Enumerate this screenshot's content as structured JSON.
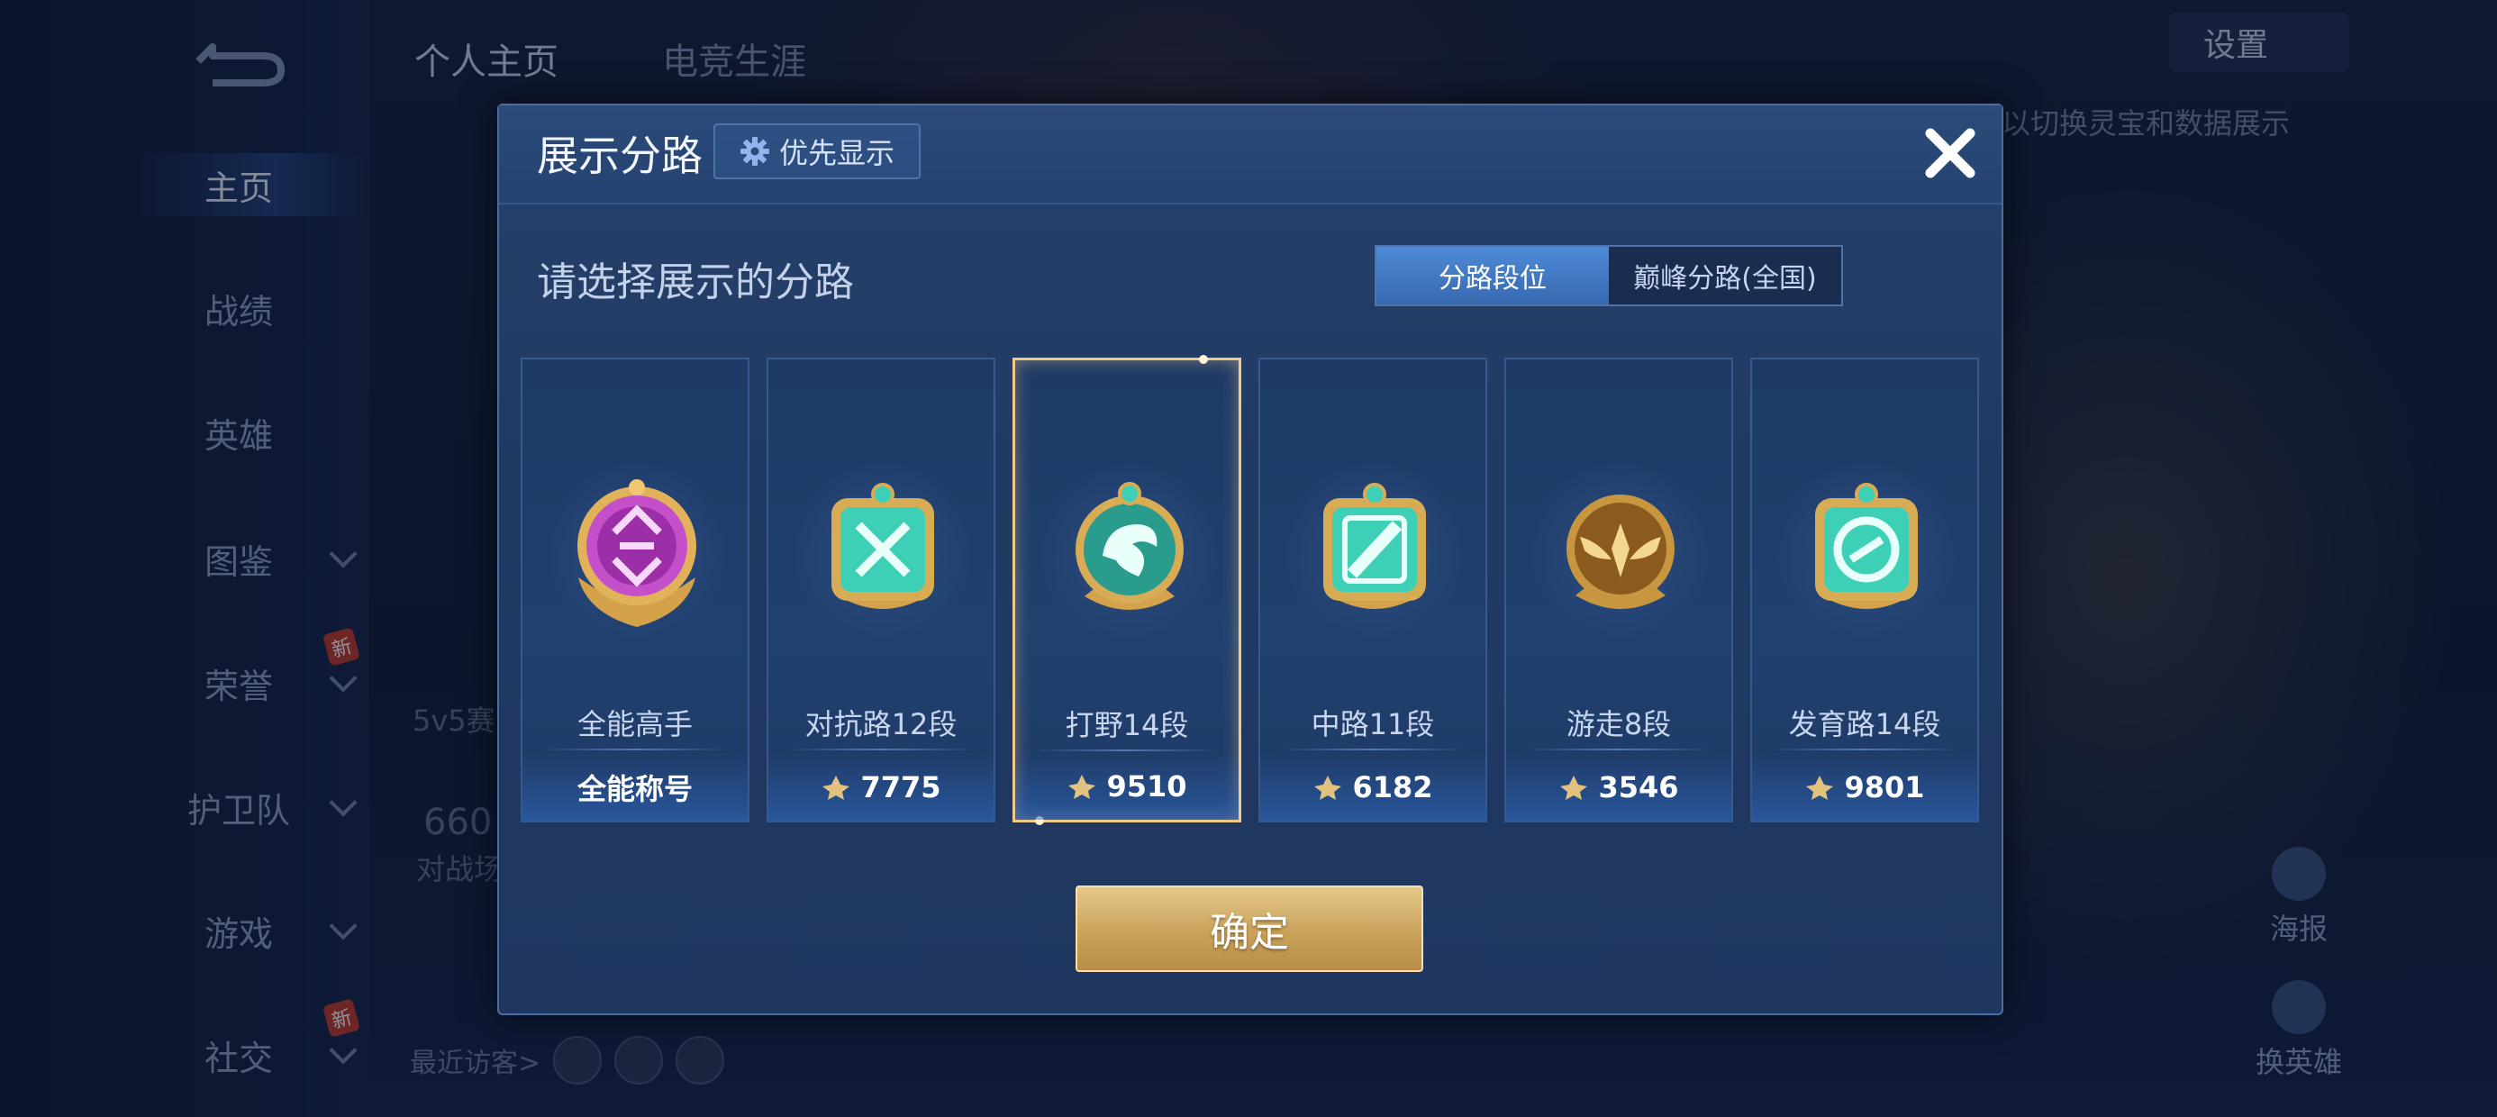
{
  "background": {
    "top_tabs": [
      "个人主页",
      "电竞生涯"
    ],
    "settings_label": "设置",
    "hint_text": "以切换灵宝和数据展示",
    "side_stats": {
      "mode_text": "5v5赛",
      "number_text": "660",
      "sub_text": "对战场"
    },
    "nav": [
      {
        "label": "主页",
        "active": true
      },
      {
        "label": "战绩"
      },
      {
        "label": "英雄"
      },
      {
        "label": "图鉴",
        "chevron": true
      },
      {
        "label": "荣誉",
        "chevron": true,
        "new": true
      },
      {
        "label": "护卫队",
        "chevron": true
      },
      {
        "label": "游戏",
        "chevron": true
      },
      {
        "label": "社交",
        "chevron": true,
        "new": true
      }
    ],
    "new_badge": "新",
    "visitors_label": "最近访客>",
    "poster_label": "海报",
    "switch_hero_label": "换英雄"
  },
  "modal": {
    "title": "展示分路",
    "priority_button": "优先显示",
    "subtitle": "请选择展示的分路",
    "tabs": [
      {
        "label": "分路段位",
        "active": true
      },
      {
        "label": "巅峰分路(全国)",
        "active": false
      }
    ],
    "cards": [
      {
        "name": "全能高手",
        "value": "全能称号",
        "badge": "all-round-badge",
        "color": "#c54fc9",
        "show_points_icon": false,
        "selected": false
      },
      {
        "name": "对抗路12段",
        "value": "7775",
        "badge": "clash-lane-badge",
        "color": "#36c9b1",
        "show_points_icon": true,
        "selected": false
      },
      {
        "name": "打野14段",
        "value": "9510",
        "badge": "jungle-badge",
        "color": "#2a9c8e",
        "show_points_icon": true,
        "selected": true
      },
      {
        "name": "中路11段",
        "value": "6182",
        "badge": "mid-lane-badge",
        "color": "#36c9b1",
        "show_points_icon": true,
        "selected": false
      },
      {
        "name": "游走8段",
        "value": "3546",
        "badge": "roam-badge",
        "color": "#a8772c",
        "show_points_icon": true,
        "selected": false
      },
      {
        "name": "发育路14段",
        "value": "9801",
        "badge": "farm-lane-badge",
        "color": "#36c9b1",
        "show_points_icon": true,
        "selected": false
      }
    ],
    "confirm_button": "确定"
  }
}
